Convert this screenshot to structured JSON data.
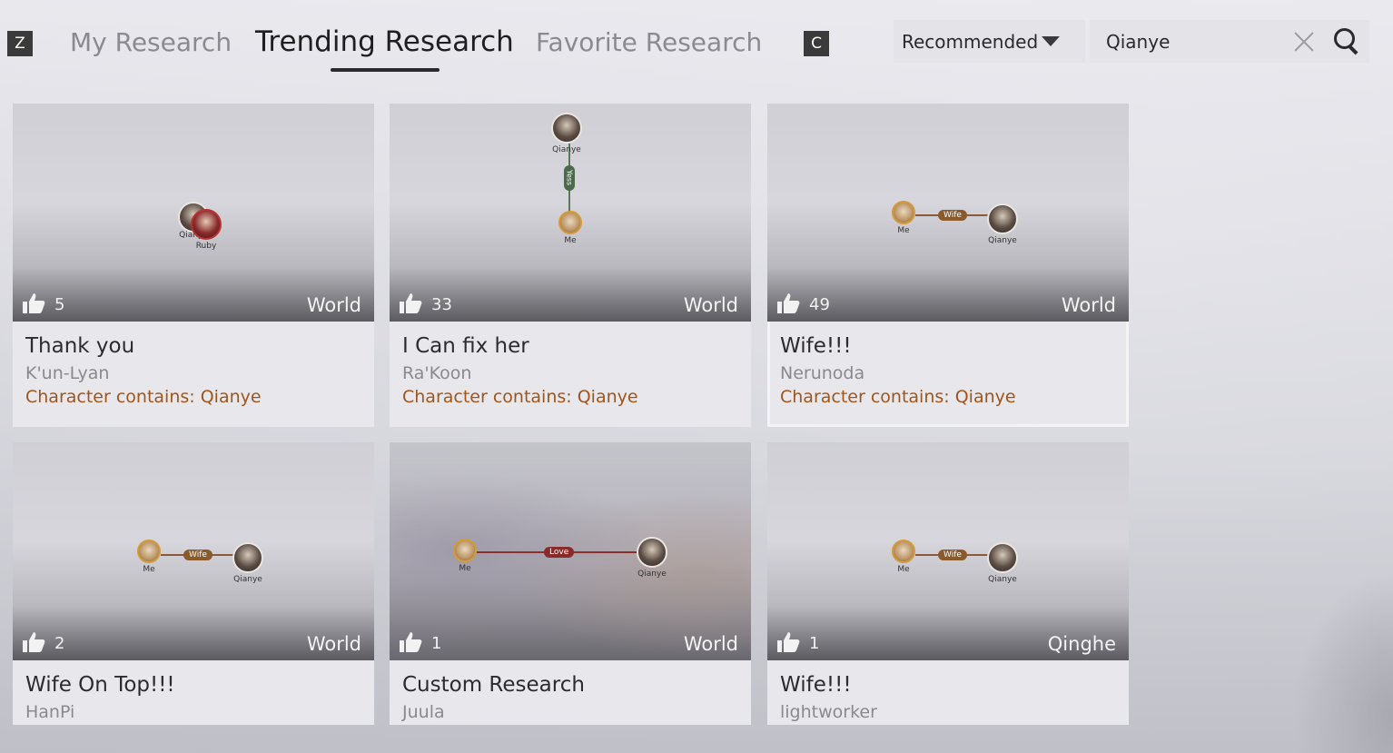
{
  "top_bar": {
    "left_key": "Z",
    "right_key": "C",
    "tabs": [
      {
        "label": "My Research"
      },
      {
        "label": "Trending Research"
      },
      {
        "label": "Favorite Research"
      }
    ],
    "sort": {
      "selected": "Recommended"
    },
    "search": {
      "value": "Qianye"
    }
  },
  "cards": [
    {
      "title": "Thank you",
      "author": "K'un-Lyan",
      "filter": "Character contains: Qianye",
      "likes": "5",
      "region": "World",
      "nodes": [
        "Qianye",
        "Ruby"
      ]
    },
    {
      "title": "I Can fix her",
      "author": "Ra'Koon",
      "filter": "Character contains: Qianye",
      "likes": "33",
      "region": "World",
      "nodes": [
        "Qianye",
        "Me"
      ],
      "relation": "Yess"
    },
    {
      "title": "Wife!!!",
      "author": "Nerunoda",
      "filter": "Character contains: Qianye",
      "likes": "49",
      "region": "World",
      "nodes": [
        "Me",
        "Qianye"
      ],
      "relation": "Wife"
    },
    {
      "title": "Wife On Top!!!",
      "author": "HanPi",
      "likes": "2",
      "region": "World",
      "nodes": [
        "Me",
        "Qianye"
      ],
      "relation": "Wife"
    },
    {
      "title": "Custom Research",
      "author": "Juula",
      "likes": "1",
      "region": "World",
      "nodes": [
        "Me",
        "Qianye"
      ],
      "relation": "Love"
    },
    {
      "title": "Wife!!!",
      "author": "lightworker",
      "likes": "1",
      "region": "Qinghe",
      "nodes": [
        "Me",
        "Qianye"
      ],
      "relation": "Wife"
    }
  ]
}
